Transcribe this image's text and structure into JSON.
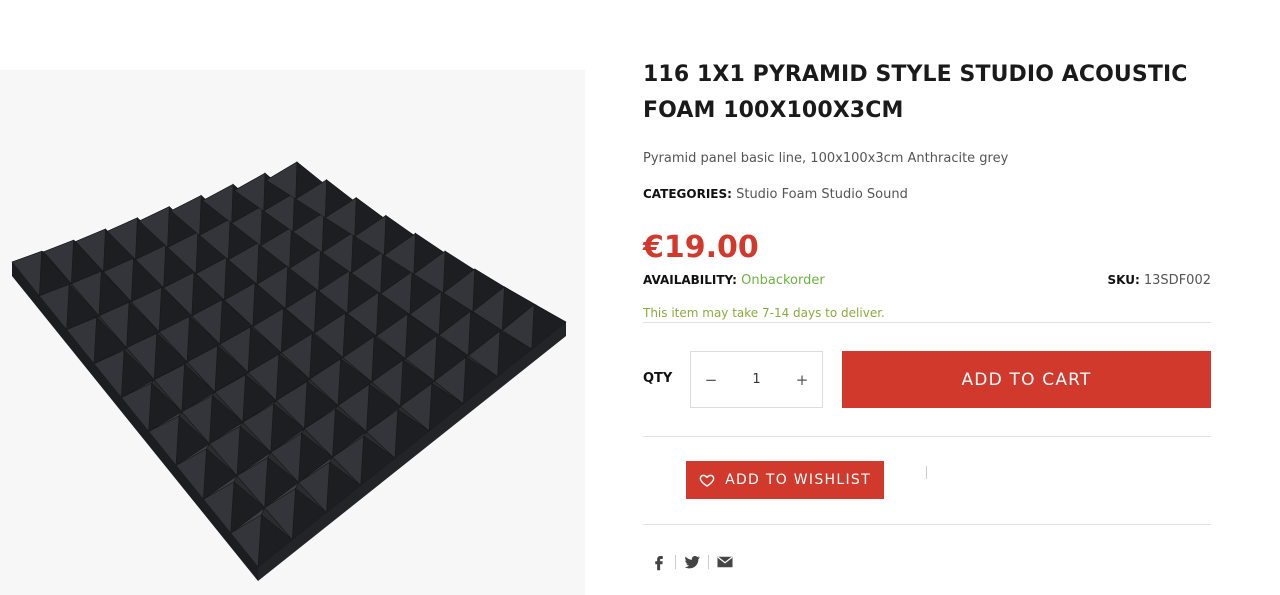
{
  "product": {
    "title": "116 1X1 PYRAMID STYLE STUDIO ACOUSTIC FOAM 100X100X3CM",
    "short_description": "Pyramid panel basic line, 100x100x3cm Anthracite grey",
    "categories_label": "CATEGORIES:",
    "categories": "Studio Foam Studio Sound",
    "price": "€19.00",
    "availability_label": "AVAILABILITY:",
    "availability_value": "Onbackorder",
    "sku_label": "SKU:",
    "sku_value": "13SDF002",
    "delivery_note": "This item may take 7-14 days to deliver."
  },
  "purchase": {
    "qty_label": "QTY",
    "qty_value": "1",
    "minus_symbol": "−",
    "plus_symbol": "+",
    "add_to_cart_label": "ADD TO CART"
  },
  "wishlist": {
    "label": "ADD TO WISHLIST",
    "icon": "heart-icon"
  },
  "share": {
    "icons": [
      "facebook-icon",
      "twitter-icon",
      "email-icon"
    ]
  },
  "colors": {
    "accent": "#d0392b",
    "availability": "#6db33f",
    "note": "#8cab3c",
    "foam": "#2e2f32"
  }
}
